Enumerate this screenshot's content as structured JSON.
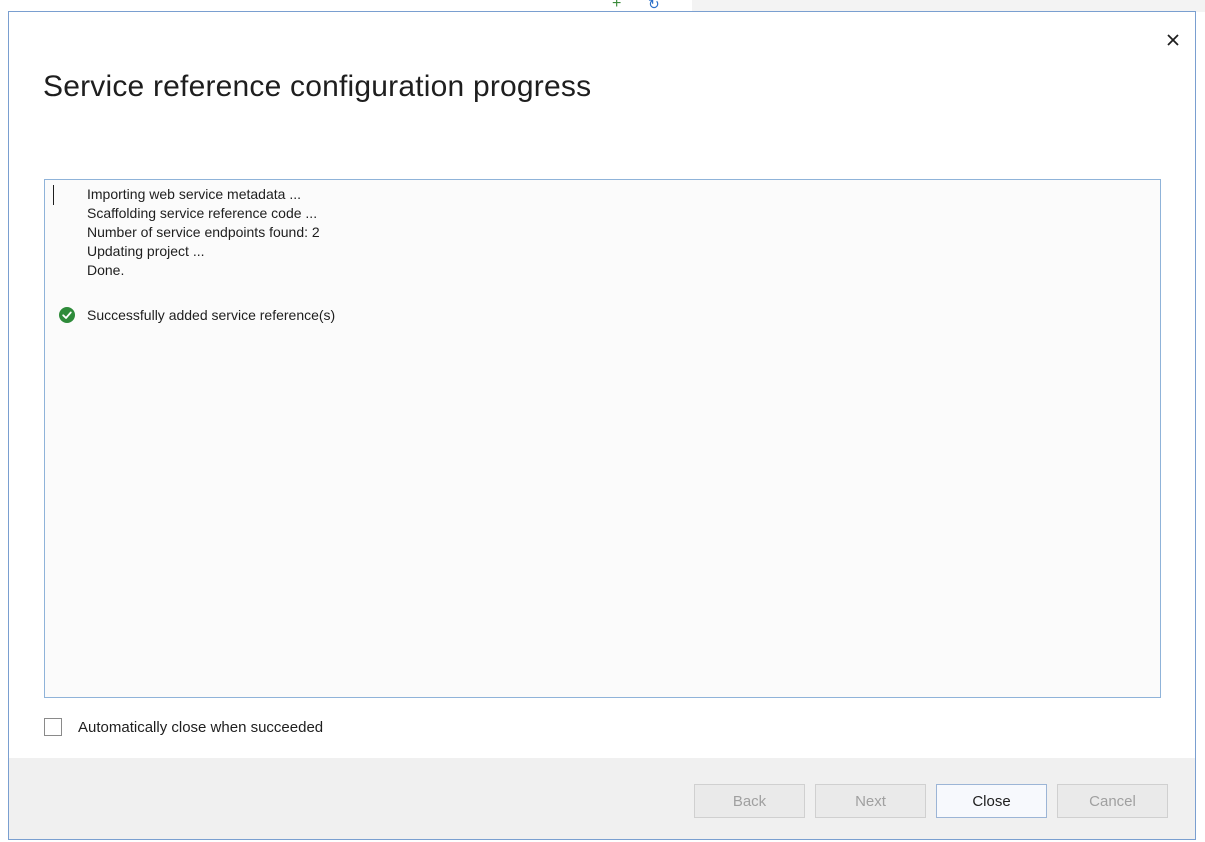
{
  "dialog": {
    "title": "Service reference configuration progress",
    "close_icon": "close-icon"
  },
  "log": {
    "lines": [
      "Importing web service metadata ...",
      "Scaffolding service reference code ...",
      "Number of service endpoints found: 2",
      "Updating project ...",
      "Done."
    ],
    "success_message": "Successfully added service reference(s)",
    "success_icon": "check-circle-icon"
  },
  "options": {
    "auto_close_label": "Automatically close when succeeded",
    "auto_close_checked": false
  },
  "buttons": {
    "back": "Back",
    "next": "Next",
    "close": "Close",
    "cancel": "Cancel"
  },
  "colors": {
    "success_green": "#2e8b3a",
    "border_blue": "#8fb3d9"
  }
}
